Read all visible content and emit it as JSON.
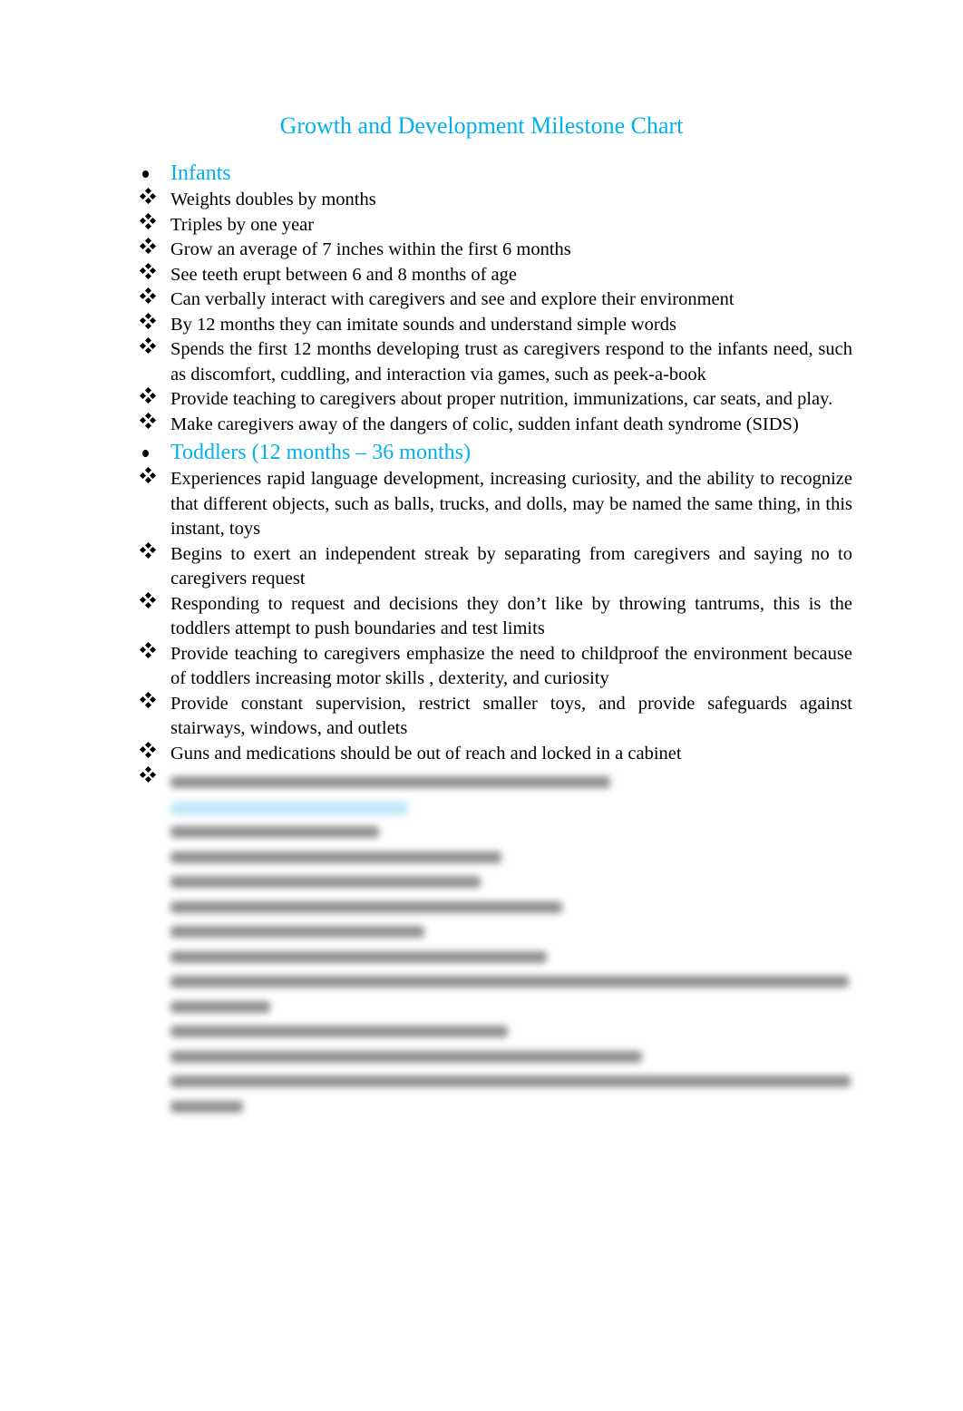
{
  "document": {
    "title": "Growth and Development Milestone Chart",
    "title_color": "#00b0f0",
    "sections": [
      {
        "heading": "Infants",
        "items": [
          "Weights doubles by months",
          "Triples by one year",
          "Grow an average of 7 inches within the first 6 months",
          "See teeth erupt between 6 and 8 months of age",
          "Can verbally interact with caregivers and see and explore their environment",
          "By 12 months they can imitate sounds and understand simple words",
          "Spends the first 12 months developing trust as caregivers respond to the infants need, such as discomfort, cuddling, and interaction via games, such as peek-a-book",
          "Provide teaching to caregivers about proper nutrition, immunizations, car seats, and play.",
          "Make caregivers away of the dangers of colic, sudden infant death syndrome (SIDS)"
        ]
      },
      {
        "heading": "Toddlers (12 months – 36 months)",
        "items": [
          "Experiences rapid language development, increasing curiosity, and the ability to recognize that different objects, such as balls, trucks, and dolls, may be named the same thing, in this instant, toys",
          "Begins to exert an independent streak by separating from caregivers and saying no to caregivers request",
          "Responding to request and decisions they don’t like by throwing tantrums, this is the toddlers attempt to push boundaries and test limits",
          "Provide teaching to caregivers emphasize the need to childproof the environment because of toddlers increasing motor skills , dexterity, and curiosity",
          "Provide constant supervision, restrict smaller toys, and provide safeguards against stairways, windows, and outlets",
          "Guns and medications should be out of reach and locked in a cabinet"
        ]
      }
    ],
    "blurred_note": "remaining content is blurred and unreadable"
  }
}
